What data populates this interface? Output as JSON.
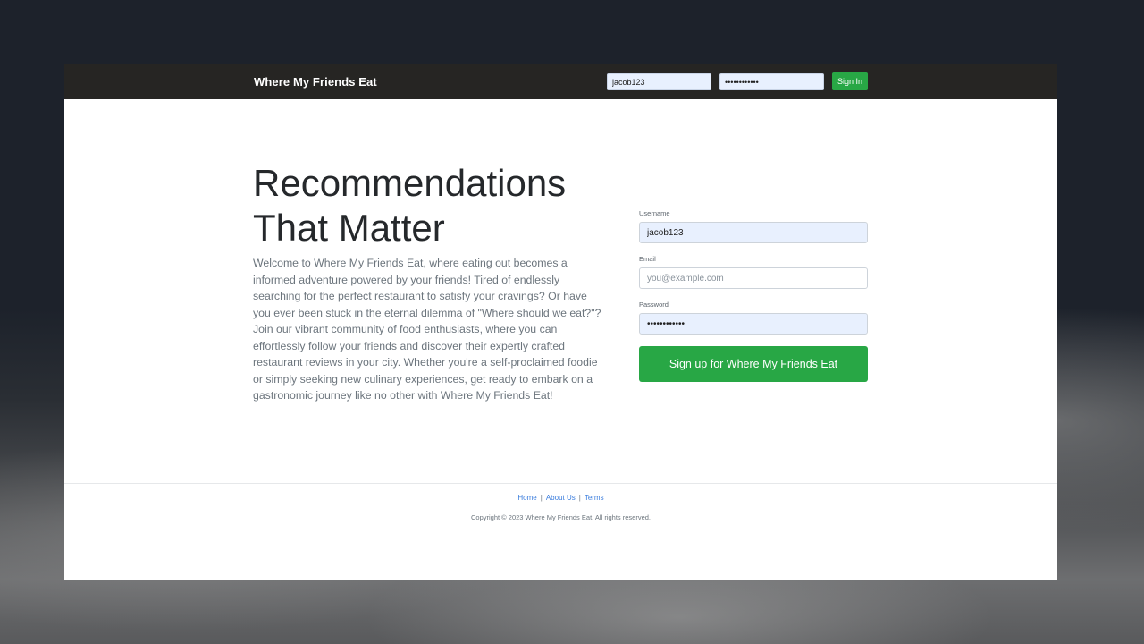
{
  "navbar": {
    "brand": "Where My Friends Eat",
    "username_value": "jacob123",
    "password_value": "••••••••••••",
    "signin_label": "Sign In"
  },
  "hero": {
    "headline_line1": "Recommendations",
    "headline_line2": "That Matter",
    "description": "Welcome to Where My Friends Eat, where eating out becomes a informed adventure powered by your friends! Tired of endlessly searching for the perfect restaurant to satisfy your cravings? Or have you ever been stuck in the eternal dilemma of \"Where should we eat?\"? Join our vibrant community of food enthusiasts, where you can effortlessly follow your friends and discover their expertly crafted restaurant reviews in your city. Whether you're a self-proclaimed foodie or simply seeking new culinary experiences, get ready to embark on a gastronomic journey like no other with Where My Friends Eat!"
  },
  "signup_form": {
    "username_label": "Username",
    "username_value": "jacob123",
    "email_label": "Email",
    "email_placeholder": "you@example.com",
    "password_label": "Password",
    "password_value": "••••••••••••",
    "submit_label": "Sign up for Where My Friends Eat"
  },
  "footer": {
    "links": [
      "Home",
      "About Us",
      "Terms"
    ],
    "separator": "|",
    "copyright": "Copyright © 2023 Where My Friends Eat. All rights reserved."
  },
  "colors": {
    "navbar_bg": "#262523",
    "accent_green": "#28a745",
    "link_blue": "#3b7ddd",
    "autofill_bg": "#e8f0fe"
  }
}
